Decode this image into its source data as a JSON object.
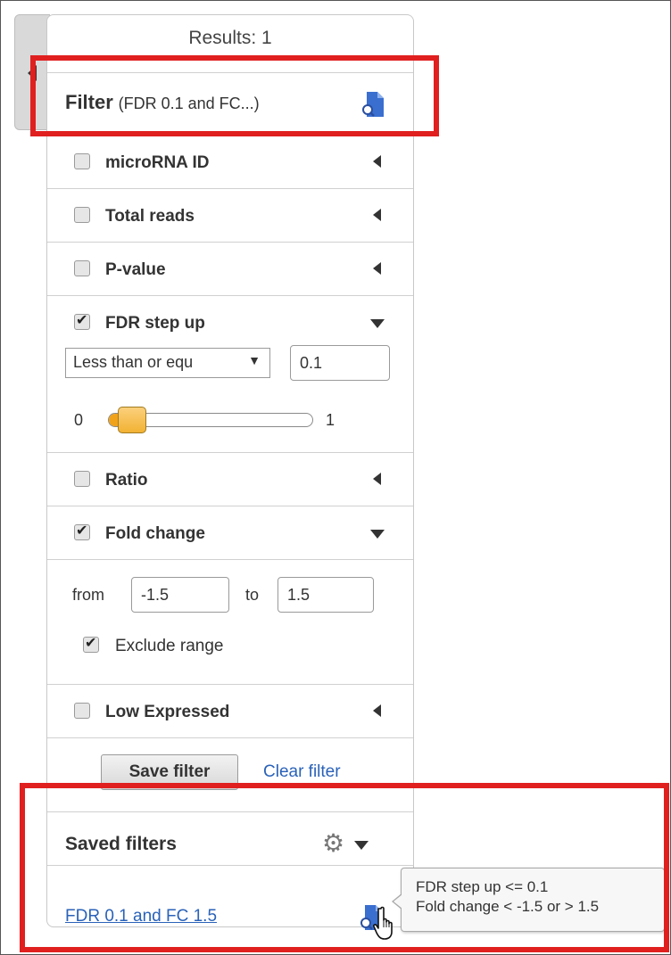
{
  "results_label": "Results: 1",
  "filter": {
    "title": "Filter",
    "subtitle": "(FDR 0.1 and FC...)",
    "icon": "filter-doc-icon"
  },
  "criteria": [
    {
      "label": "microRNA ID",
      "checked": false,
      "expanded": false
    },
    {
      "label": "Total reads",
      "checked": false,
      "expanded": false
    },
    {
      "label": "P-value",
      "checked": false,
      "expanded": false
    },
    {
      "label": "FDR step up",
      "checked": true,
      "expanded": true
    },
    {
      "label": "Ratio",
      "checked": false,
      "expanded": false
    },
    {
      "label": "Fold change",
      "checked": true,
      "expanded": true
    },
    {
      "label": "Low Expressed",
      "checked": false,
      "expanded": false
    }
  ],
  "fdr": {
    "operator": "Less than or equ",
    "operator_arrow": "▼",
    "value": "0.1",
    "slider_min": "0",
    "slider_max": "1",
    "slider_level": 0.1
  },
  "fold_change": {
    "from_label": "from",
    "from_value": "-1.5",
    "to_label": "to",
    "to_value": "1.5",
    "exclude_label": "Exclude range",
    "exclude_checked": true
  },
  "buttons": {
    "save": "Save filter",
    "clear": "Clear filter"
  },
  "saved": {
    "title": "Saved filters",
    "gear_glyph": "⚙",
    "item": "FDR 0.1 and FC 1.5",
    "tooltip": [
      "FDR step up <= 0.1",
      "Fold change < -1.5 or > 1.5"
    ]
  },
  "colors": {
    "highlight": "#e0201f",
    "link": "#2a62b8",
    "slider": "#f0a21b",
    "icon_blue": "#3a6fd0"
  }
}
